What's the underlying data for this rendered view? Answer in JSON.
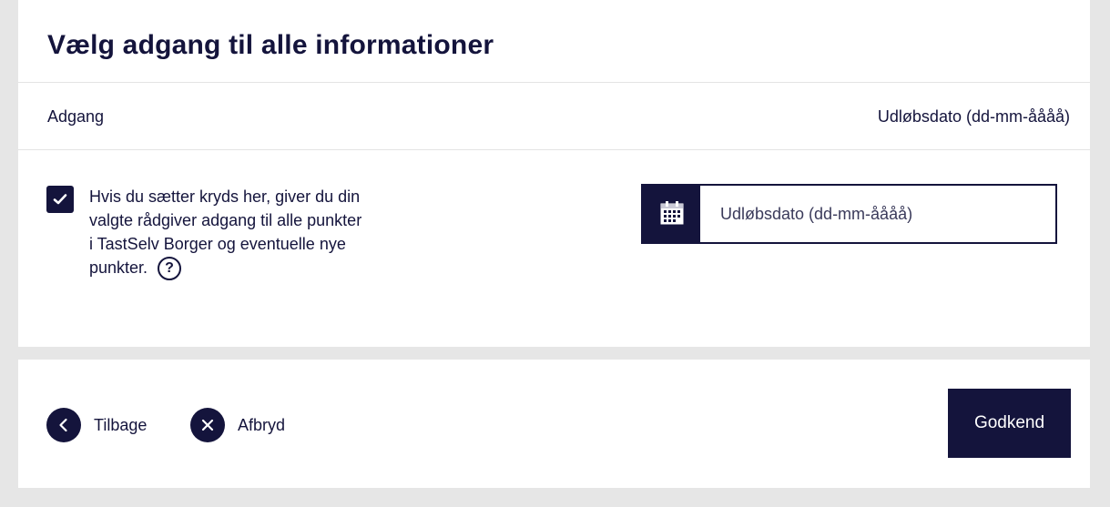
{
  "header": {
    "title": "Vælg adgang til alle informationer"
  },
  "table_header": {
    "left": "Adgang",
    "right": "Udløbsdato (dd-mm-åååå)"
  },
  "access_option": {
    "checked": true,
    "lines": [
      "Hvis du sætter kryds her, giver du din",
      "valgte rådgiver adgang til alle punkter",
      "i TastSelv Borger og eventuelle nye",
      "punkter."
    ],
    "help_glyph": "?"
  },
  "expiry_date": {
    "value": "",
    "placeholder": "Udløbsdato (dd-mm-åååå)",
    "icon": "calendar-icon"
  },
  "footer": {
    "back_label": "Tilbage",
    "cancel_label": "Afbryd",
    "approve_label": "Godkend"
  },
  "colors": {
    "primary": "#14143c",
    "background": "#e6e6e6",
    "card": "#ffffff",
    "divider": "#e4e4e4"
  }
}
